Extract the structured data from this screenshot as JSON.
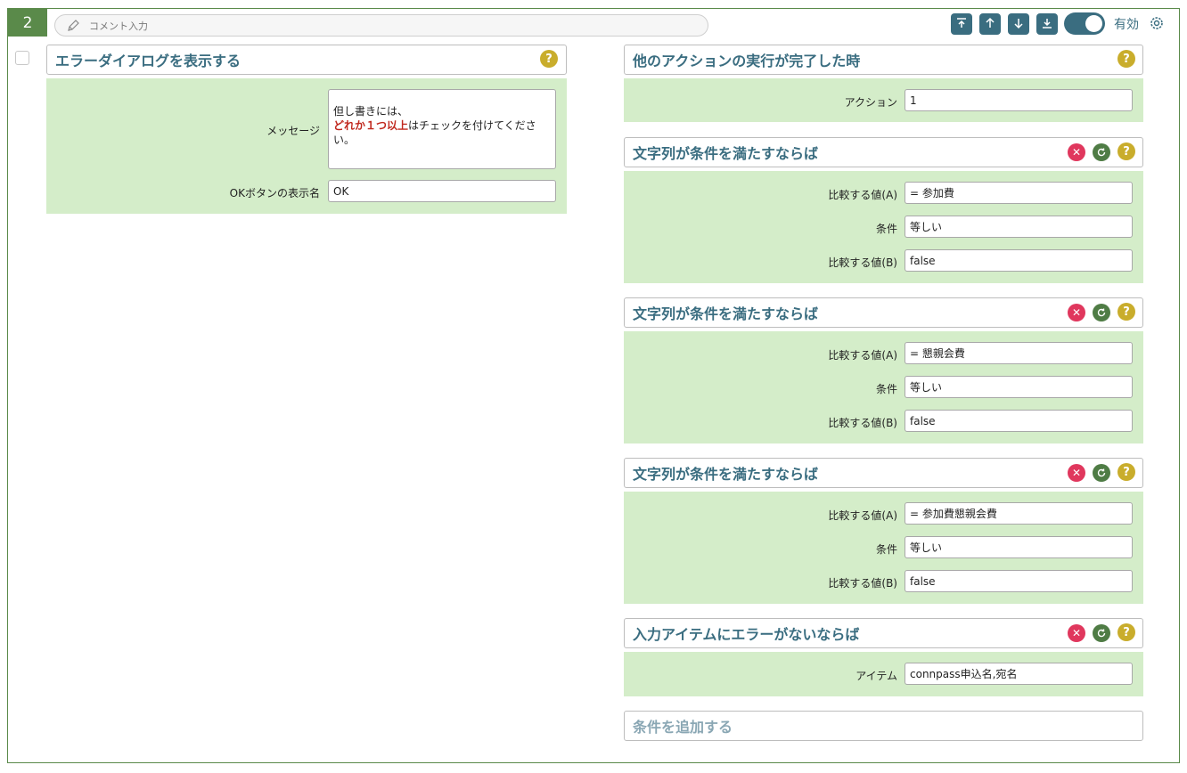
{
  "step_number": "2",
  "comment": {
    "placeholder": "コメント入力"
  },
  "toolbar": {
    "enabled_label": "有効",
    "enabled": true
  },
  "colors": {
    "accent": "#3a6d80",
    "brand_green": "#5a8a4a",
    "panel_bg": "#d4edc9",
    "help": "#c9ad2c",
    "delete": "#e0375d",
    "reset": "#4f7c45",
    "highlight_text": "#c0281e"
  },
  "action": {
    "title": "エラーダイアログを表示する",
    "message_label": "メッセージ",
    "message": {
      "line1": "但し書きには、",
      "highlight": "どれか１つ以上",
      "line2_rest": "はチェックを付けてくださ",
      "line3": "い。"
    },
    "ok_label": "OKボタンの表示名",
    "ok_value": "OK"
  },
  "triggers": [
    {
      "title": "他のアクションの実行が完了した時",
      "action_label": "アクション",
      "action_value": "1"
    }
  ],
  "conditions": [
    {
      "title": "文字列が条件を満たすならば",
      "a_label": "比較する値(A)",
      "a_value": "= 参加費",
      "cond_label": "条件",
      "cond_value": "等しい",
      "b_label": "比較する値(B)",
      "b_value": "false"
    },
    {
      "title": "文字列が条件を満たすならば",
      "a_label": "比較する値(A)",
      "a_value": "= 懇親会費",
      "cond_label": "条件",
      "cond_value": "等しい",
      "b_label": "比較する値(B)",
      "b_value": "false"
    },
    {
      "title": "文字列が条件を満たすならば",
      "a_label": "比較する値(A)",
      "a_value": "= 参加費懇親会費",
      "cond_label": "条件",
      "cond_value": "等しい",
      "b_label": "比較する値(B)",
      "b_value": "false"
    }
  ],
  "no_error": {
    "title": "入力アイテムにエラーがないならば",
    "item_label": "アイテム",
    "item_value": "connpass申込名,宛名"
  },
  "add_condition": {
    "label": "条件を追加する"
  },
  "icons": [
    "pencil-icon",
    "move-top-icon",
    "move-up-icon",
    "move-down-icon",
    "move-bottom-icon",
    "gear-icon",
    "help-icon",
    "delete-icon",
    "reset-icon"
  ]
}
